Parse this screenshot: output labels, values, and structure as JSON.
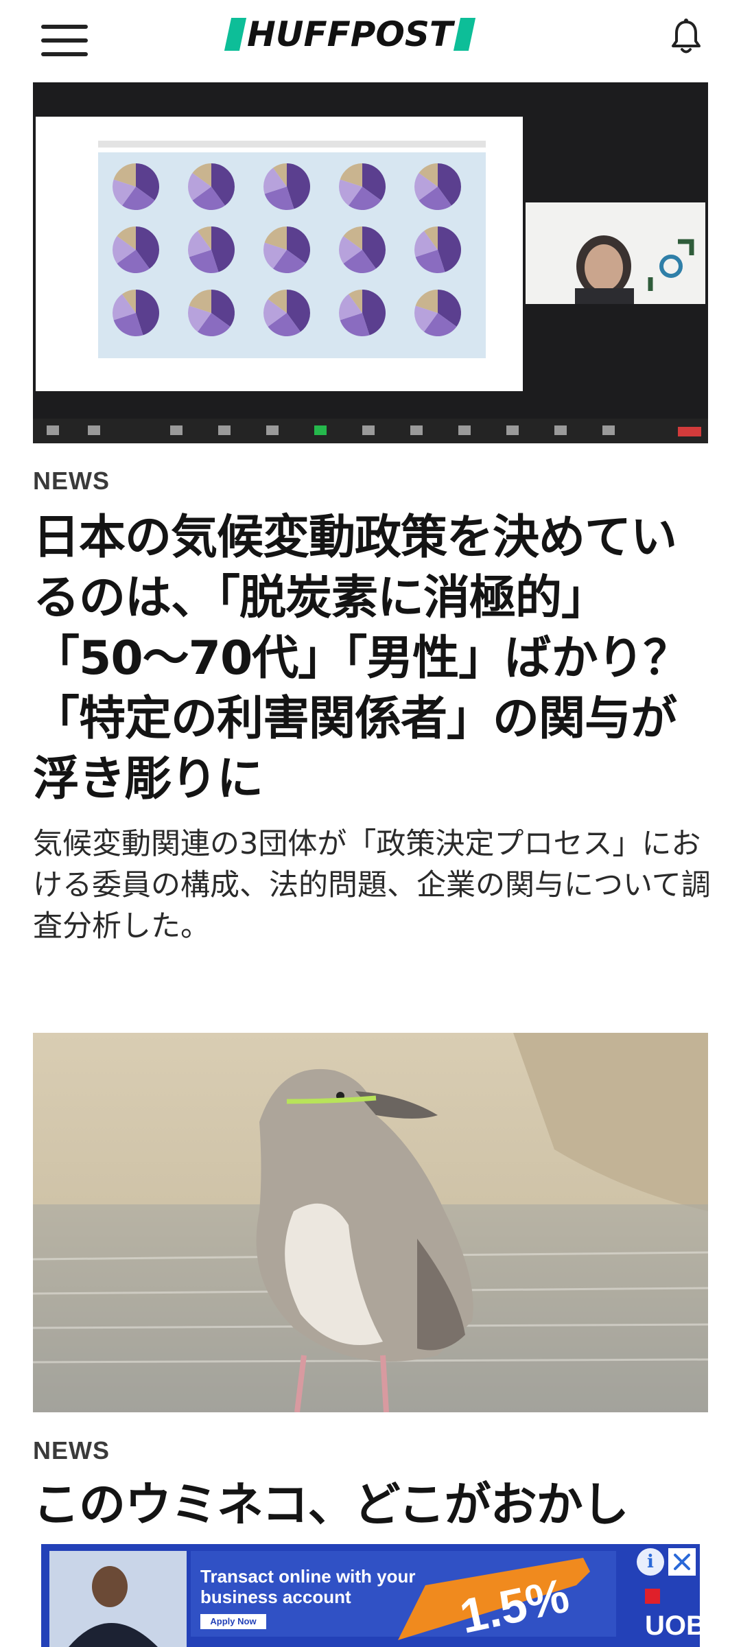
{
  "header": {
    "brand_name": "HUFFPOST",
    "menu_icon": "hamburger-menu-icon",
    "notification_icon": "bell-icon"
  },
  "articles": [
    {
      "section": "NEWS",
      "headline": "日本の気候変動政策を決めているのは、「脱炭素に消極的」「50〜70代」「男性」ばかり？「特定の利害関係者」の関与が浮き彫りに",
      "summary": "気候変動関連の3団体が「政策決定プロセス」における委員の構成、法的問題、企業の関与について調査分析した。"
    },
    {
      "section": "NEWS",
      "headline": "このウミネコ、どこがおかし"
    }
  ],
  "ad": {
    "headline": "Transact online with your business account",
    "cta": "Apply Now",
    "rate": "1.5%",
    "brand": "UOB",
    "info_icon": "info-icon",
    "close_icon": "close-icon"
  },
  "colors": {
    "brand_accent": "#0dbe98",
    "ad_background": "#2341b8",
    "ad_orange": "#f08a1e"
  }
}
